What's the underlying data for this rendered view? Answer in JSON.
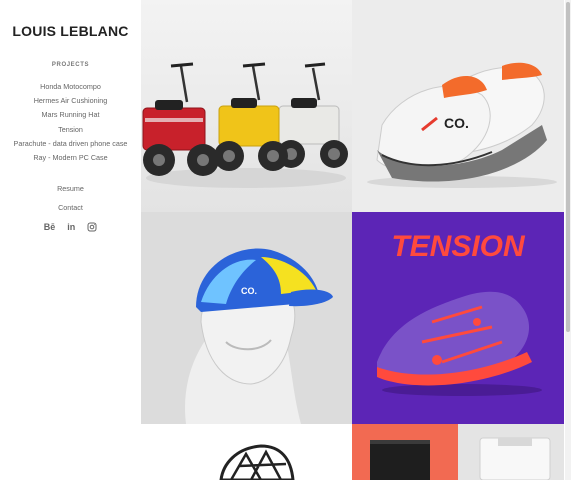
{
  "site": {
    "title": "LOUIS LEBLANC"
  },
  "nav": {
    "projects_heading": "PROJECTS",
    "projects": [
      "Honda Motocompo",
      "Hermes Air Cushioning",
      "Mars Running Hat",
      "Tension",
      "Parachute - data driven phone case",
      "Ray - Modern PC Case"
    ],
    "resume": "Resume",
    "contact": "Contact"
  },
  "social": {
    "behance": "Bē",
    "linkedin": "in"
  },
  "tiles": {
    "tension_title": "TENSION",
    "shoe_logo": "CO.",
    "hat_logo": "CO."
  },
  "colors": {
    "tension_purple": "#5c25b6",
    "tension_red": "#ff4a3d",
    "accent_orange": "#f26a52"
  }
}
